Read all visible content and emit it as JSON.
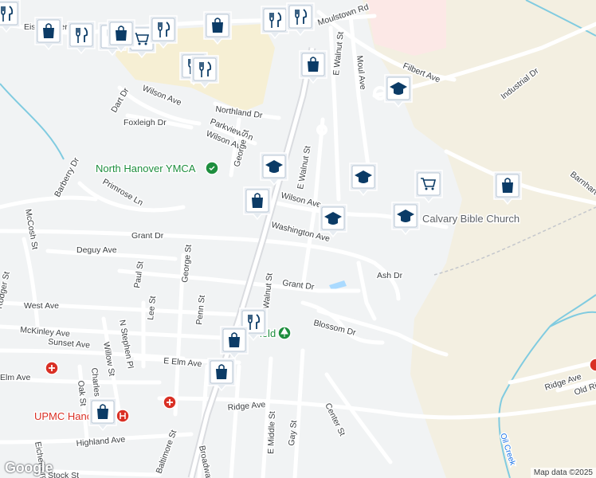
{
  "streets": [
    "Moulstown Rd",
    "Moul Ave",
    "E Walnut St",
    "Eisenhower Dr",
    "Filbert Ave",
    "Industrial Dr",
    "Dart Dr",
    "Wilson Ave",
    "Foxleigh Dr",
    "Northland Dr",
    "Parkview Ln",
    "Wilson Ave",
    "George St",
    "E Walnut St",
    "Barberry Dr",
    "Primrose Ln",
    "Wilson Ave",
    "McCosh St",
    "Grant Dr",
    "Washington Ave",
    "Barnhart Dr",
    "Deguy Ave",
    "Ash Dr",
    "Paul St",
    "George St",
    "Grant Dr",
    "Walnut St",
    "West Ave",
    "Lee St",
    "Penn St",
    "McKinley Ave",
    "N Stephen Pl",
    "Blossom Dr",
    "Sunset Ave",
    "Willow St",
    "E Elm Ave",
    "Elm Ave",
    "Charles St",
    "Oak St",
    "Ridge Ave",
    "E Middle St",
    "Gay St",
    "Center St",
    "Ridge Ave",
    "Old Ridge Rd",
    "Highland Ave",
    "Eichelberger St",
    "Stock St",
    "Baltimore St",
    "Broadway",
    "Rodger St"
  ],
  "pois": {
    "ymca": "North Hanover YMCA",
    "church": "Calvary Bible Church",
    "hospital": "UPMC Hanover",
    "park": "Field",
    "creek": "Oil Creek"
  },
  "markers": [
    {
      "type": "restaurant",
      "icon": "fork-knife-icon"
    },
    {
      "type": "shopping",
      "icon": "shopping-bag-icon"
    },
    {
      "type": "restaurant",
      "icon": "fork-knife-icon"
    },
    {
      "type": "restaurant",
      "icon": "fork-knife-icon"
    },
    {
      "type": "grocery",
      "icon": "shopping-cart-icon"
    },
    {
      "type": "restaurant",
      "icon": "fork-knife-icon"
    },
    {
      "type": "shopping",
      "icon": "shopping-bag-icon"
    },
    {
      "type": "restaurant",
      "icon": "fork-knife-icon"
    },
    {
      "type": "restaurant",
      "icon": "fork-knife-icon"
    },
    {
      "type": "restaurant",
      "icon": "fork-knife-icon"
    },
    {
      "type": "restaurant",
      "icon": "fork-knife-icon"
    },
    {
      "type": "shopping",
      "icon": "shopping-bag-icon"
    },
    {
      "type": "school",
      "icon": "graduation-cap-icon"
    },
    {
      "type": "school",
      "icon": "graduation-cap-icon"
    },
    {
      "type": "school",
      "icon": "graduation-cap-icon"
    },
    {
      "type": "grocery",
      "icon": "shopping-cart-icon"
    },
    {
      "type": "shopping",
      "icon": "shopping-bag-icon"
    },
    {
      "type": "shopping",
      "icon": "shopping-bag-icon"
    },
    {
      "type": "school",
      "icon": "graduation-cap-icon"
    },
    {
      "type": "school",
      "icon": "graduation-cap-icon"
    },
    {
      "type": "restaurant",
      "icon": "fork-knife-icon"
    },
    {
      "type": "shopping",
      "icon": "shopping-bag-icon"
    },
    {
      "type": "shopping",
      "icon": "shopping-bag-icon"
    },
    {
      "type": "shopping",
      "icon": "shopping-bag-icon"
    },
    {
      "type": "shopping",
      "icon": "shopping-bag-icon"
    }
  ],
  "colors": {
    "land": "#f1f3f4",
    "road": "#ffffff",
    "highway": "#dadce0",
    "industrial": "#f3efe1",
    "commercial": "#f6efd4",
    "medical": "#fce8e6",
    "water": "#aadaff",
    "creek": "#80cbe0",
    "marker": "#0b3b66",
    "rail": "#c4c7cc"
  },
  "branding": {
    "logo": "Google",
    "attribution": "Map data ©2025"
  }
}
